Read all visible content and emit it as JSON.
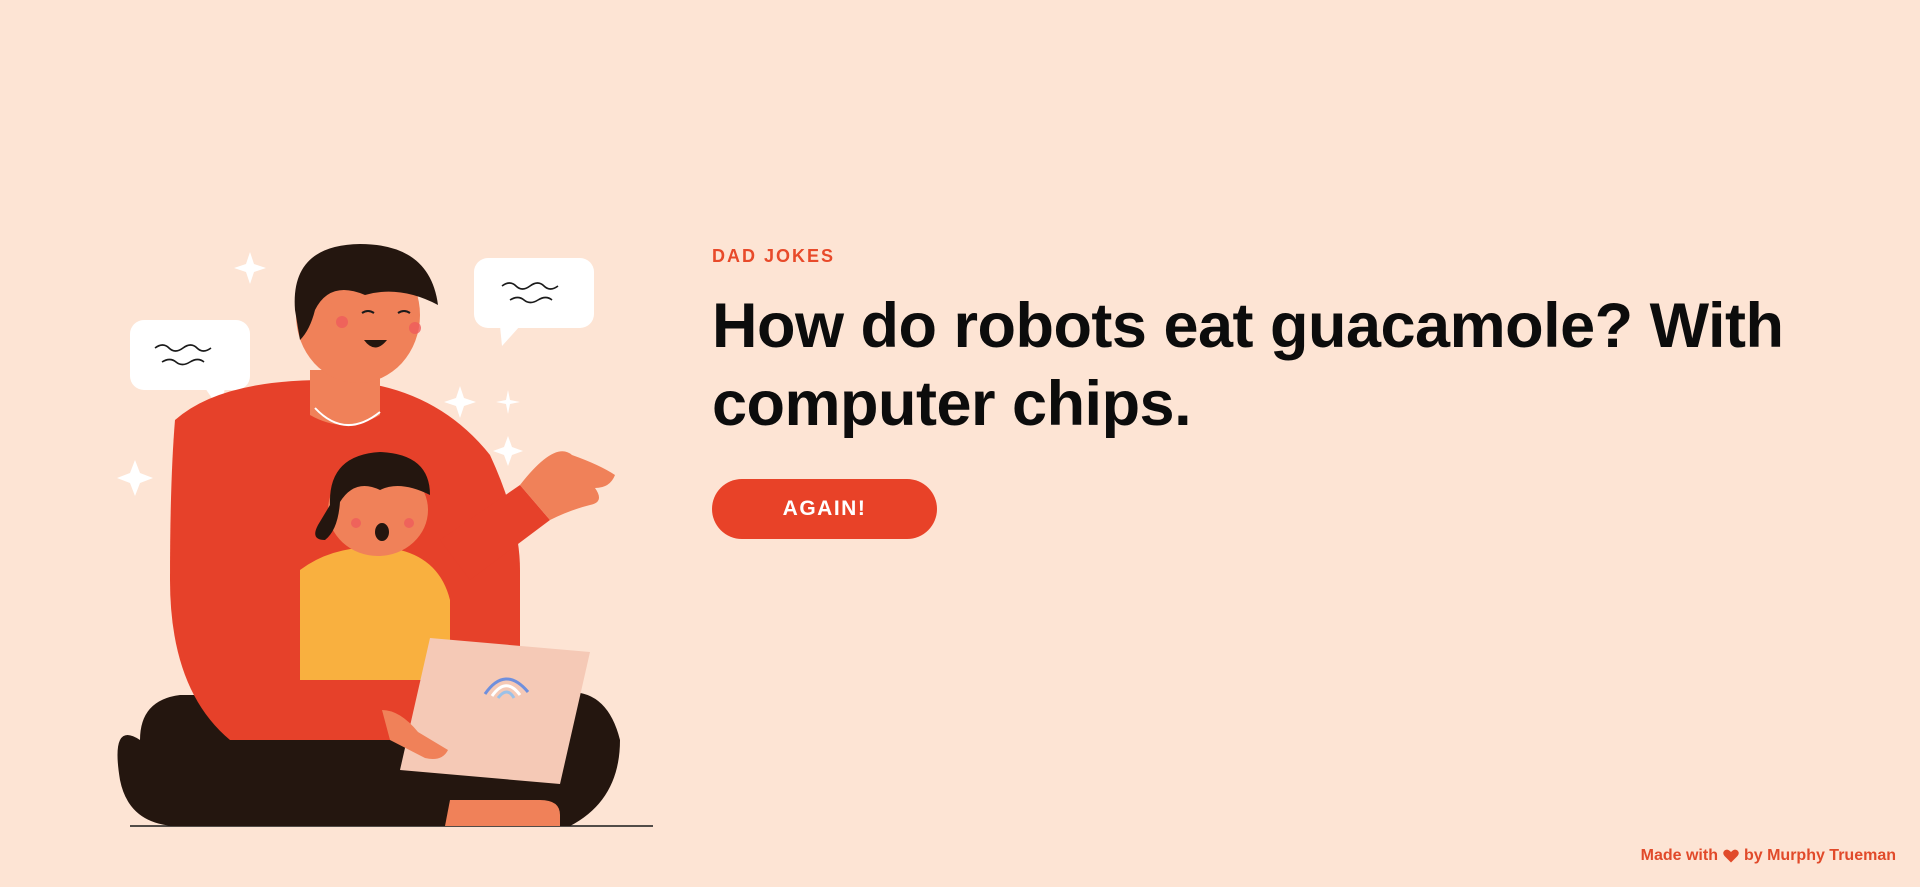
{
  "hero": {
    "eyebrow": "DAD JOKES",
    "joke": "How do robots eat guacamole? With computer chips.",
    "button_label": "AGAIN!"
  },
  "illustration": {
    "icon": "father-reading-to-child-illustration"
  },
  "footer": {
    "prefix": "Made with",
    "icon": "heart-icon",
    "suffix": "by Murphy Trueman"
  },
  "colors": {
    "background": "#fde4d4",
    "accent": "#e84228",
    "text": "#0c0c0c"
  }
}
